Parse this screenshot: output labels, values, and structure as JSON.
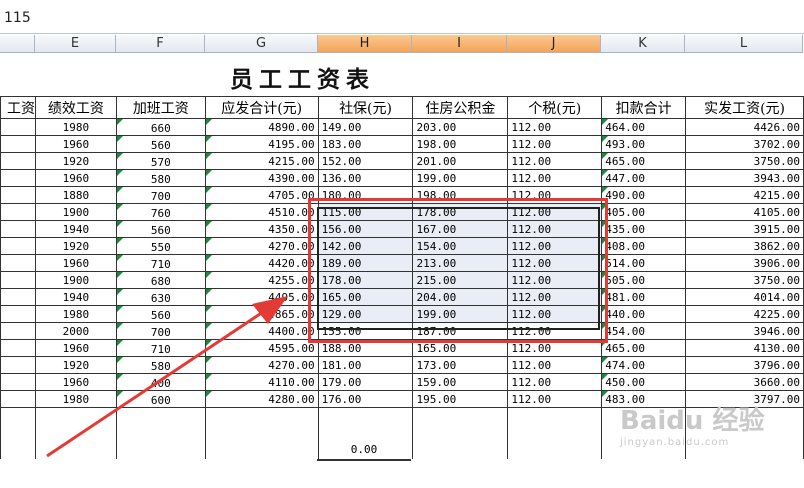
{
  "formula_bar": {
    "value": "115"
  },
  "columns": [
    {
      "letter": "E",
      "selected": false
    },
    {
      "letter": "F",
      "selected": false
    },
    {
      "letter": "G",
      "selected": false
    },
    {
      "letter": "H",
      "selected": true
    },
    {
      "letter": "I",
      "selected": true
    },
    {
      "letter": "J",
      "selected": true
    },
    {
      "letter": "K",
      "selected": false
    },
    {
      "letter": "L",
      "selected": false
    }
  ],
  "sheet_title": "员工工资表",
  "headers": [
    "工资",
    "绩效工资",
    "加班工资",
    "应发合计(元)",
    "社保(元)",
    "住房公积金",
    "个税(元)",
    "扣款合计",
    "实发工资(元)"
  ],
  "rows": [
    [
      "1980",
      "660",
      "4890.00",
      "149.00",
      "203.00",
      "112.00",
      "464.00",
      "4426.00"
    ],
    [
      "1960",
      "560",
      "4195.00",
      "183.00",
      "198.00",
      "112.00",
      "493.00",
      "3702.00"
    ],
    [
      "1920",
      "570",
      "4215.00",
      "152.00",
      "201.00",
      "112.00",
      "465.00",
      "3750.00"
    ],
    [
      "1960",
      "580",
      "4390.00",
      "136.00",
      "199.00",
      "112.00",
      "447.00",
      "3943.00"
    ],
    [
      "1880",
      "700",
      "4705.00",
      "180.00",
      "198.00",
      "112.00",
      "490.00",
      "4215.00"
    ],
    [
      "1900",
      "760",
      "4510.00",
      "115.00",
      "178.00",
      "112.00",
      "405.00",
      "4105.00"
    ],
    [
      "1940",
      "560",
      "4350.00",
      "156.00",
      "167.00",
      "112.00",
      "435.00",
      "3915.00"
    ],
    [
      "1920",
      "550",
      "4270.00",
      "142.00",
      "154.00",
      "112.00",
      "408.00",
      "3862.00"
    ],
    [
      "1960",
      "710",
      "4420.00",
      "189.00",
      "213.00",
      "112.00",
      "514.00",
      "3906.00"
    ],
    [
      "1900",
      "680",
      "4255.00",
      "178.00",
      "215.00",
      "112.00",
      "505.00",
      "3750.00"
    ],
    [
      "1940",
      "630",
      "4495.00",
      "165.00",
      "204.00",
      "112.00",
      "481.00",
      "4014.00"
    ],
    [
      "1980",
      "560",
      "4865.00",
      "129.00",
      "199.00",
      "112.00",
      "440.00",
      "4225.00"
    ],
    [
      "2000",
      "700",
      "4400.00",
      "155.00",
      "187.00",
      "112.00",
      "454.00",
      "3946.00"
    ],
    [
      "1960",
      "710",
      "4595.00",
      "188.00",
      "165.00",
      "112.00",
      "465.00",
      "4130.00"
    ],
    [
      "1920",
      "580",
      "4270.00",
      "181.00",
      "173.00",
      "112.00",
      "474.00",
      "3796.00"
    ],
    [
      "1960",
      "400",
      "4110.00",
      "179.00",
      "159.00",
      "112.00",
      "450.00",
      "3660.00"
    ],
    [
      "1980",
      "600",
      "4280.00",
      "176.00",
      "195.00",
      "112.00",
      "483.00",
      "3797.00"
    ]
  ],
  "selected_rows": [
    5,
    6,
    7,
    8,
    9,
    10,
    11
  ],
  "sum_value": "0.00",
  "watermark": {
    "text": "Baidu 经验",
    "sub": "jingyan.baidu.com"
  }
}
